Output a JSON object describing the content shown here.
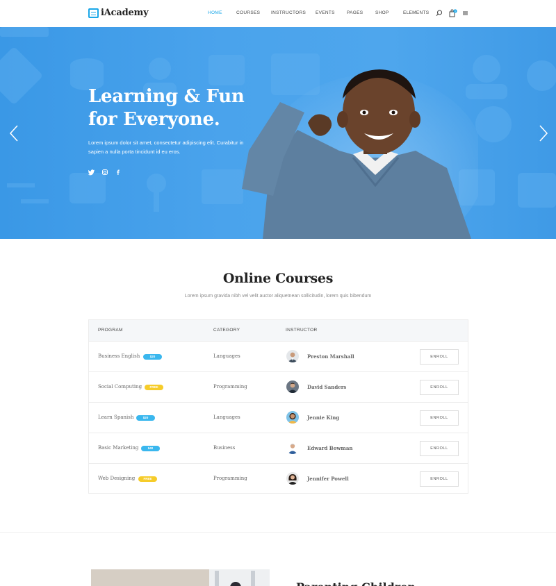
{
  "brand": {
    "name": "iAcademy",
    "accent": "#1aa7e8"
  },
  "nav": {
    "items": [
      "HOME",
      "COURSES",
      "INSTRUCTORS",
      "EVENTS",
      "PAGES",
      "SHOP",
      "ELEMENTS"
    ],
    "active": "HOME",
    "cart_count": "0",
    "icons": [
      "search-icon",
      "cart-icon",
      "menu-icon"
    ]
  },
  "hero": {
    "title_line1": "Learning & Fun",
    "title_line2": "for Everyone.",
    "description": "Lorem ipsum dolor sit amet, consectetur adipiscing elit. Curabitur in sapien a nulla porta tincidunt id eu eros.",
    "social": [
      "twitter-icon",
      "instagram-icon",
      "facebook-icon"
    ],
    "arrows": [
      "arrow-left-icon",
      "arrow-right-icon"
    ]
  },
  "courses": {
    "title": "Online Courses",
    "subtitle": "Lorem ipsum gravida nibh vel velit auctor aliquetnean sollicitudin, lorem quis bibendum",
    "columns": [
      "PROGRAM",
      "CATEGORY",
      "INSTRUCTOR"
    ],
    "rows": [
      {
        "program": "Business English",
        "price": "$20",
        "price_type": "paid",
        "category": "Languages",
        "instructor": "Preston Marshall",
        "action": "ENROLL"
      },
      {
        "program": "Social Computing",
        "price": "FREE",
        "price_type": "free",
        "category": "Programming",
        "instructor": "David Sanders",
        "action": "ENROLL"
      },
      {
        "program": "Learn Spanish",
        "price": "$20",
        "price_type": "paid",
        "category": "Languages",
        "instructor": "Jennie King",
        "action": "ENROLL"
      },
      {
        "program": "Basic Marketing",
        "price": "$40",
        "price_type": "paid",
        "category": "Business",
        "instructor": "Edward Bowman",
        "action": "ENROLL"
      },
      {
        "program": "Web Designing",
        "price": "FREE",
        "price_type": "free",
        "category": "Programming",
        "instructor": "Jennifer Powell",
        "action": "ENROLL"
      }
    ]
  },
  "next_section": {
    "heading": "Parenting Children"
  },
  "colors": {
    "hero_blue": "#4aa3ec",
    "badge_paid": "#3ab7ee",
    "badge_free": "#f6cc2a"
  }
}
